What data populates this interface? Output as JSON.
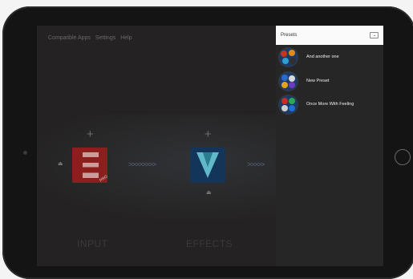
{
  "nav": {
    "items": [
      "Compatible Apps",
      "Settings",
      "Help"
    ]
  },
  "chain": {
    "add_glyph": "+",
    "chevrons_left": ">>>>>>>>",
    "chevrons_right": ">>>>>",
    "input_label": "INPUT",
    "effects_label": "EFFECTS",
    "pro_badge": "PRO"
  },
  "presets": {
    "title": "Presets",
    "items": [
      {
        "name": "And another one"
      },
      {
        "name": "New Preset"
      },
      {
        "name": "Once More With Feeling"
      }
    ]
  },
  "colors": {
    "accent_input": "#8d1e1e",
    "accent_effect": "#14355a",
    "accent_output": "#a1461a"
  }
}
